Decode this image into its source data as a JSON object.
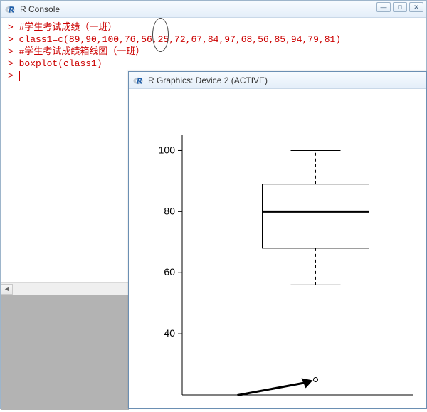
{
  "console": {
    "title": "R Console",
    "lines": {
      "l1": "#学生考试成绩（一班）",
      "l2": "class1=c(89,90,100,76,56,25,72,67,84,97,68,56,85,94,79,81)",
      "l3": "#学生考试成绩箱线图（一班）",
      "l4": "boxplot(class1)"
    },
    "prompt": ">"
  },
  "graphics": {
    "title": "R Graphics: Device 2 (ACTIVE)"
  },
  "win_controls": {
    "min": "—",
    "max": "□",
    "close": "✕"
  },
  "chart_data": {
    "type": "boxplot",
    "title": "",
    "xlabel": "",
    "ylabel": "",
    "ylim": [
      20,
      105
    ],
    "yticks": [
      40,
      60,
      80,
      100
    ],
    "series": [
      {
        "name": "class1",
        "min_whisker": 56,
        "q1": 68,
        "median": 80,
        "q3": 89,
        "max_whisker": 100,
        "outliers": [
          25
        ]
      }
    ]
  }
}
